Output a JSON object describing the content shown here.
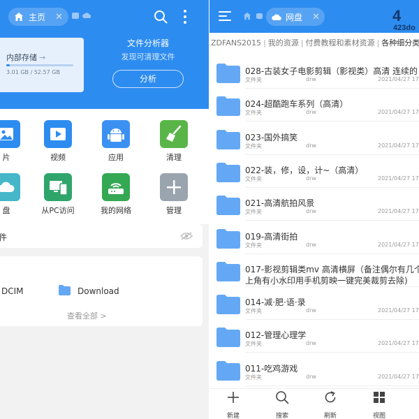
{
  "left": {
    "home_tab": {
      "label": "主页",
      "close": "✕"
    },
    "storage": {
      "title": "内部存储",
      "arrow": "→",
      "usage": "3.01 GB / 52.57 GB",
      "used_fraction": 0.057
    },
    "analyzer": {
      "title": "文件分析器",
      "subtitle": "发现可清理文件",
      "button": "分析"
    },
    "grid": [
      {
        "label": "片",
        "icon": "image-icon",
        "color": "#2d8cf0"
      },
      {
        "label": "视频",
        "icon": "video-icon",
        "color": "#2d8cf0"
      },
      {
        "label": "应用",
        "icon": "android-icon",
        "color": "#3b91f2"
      },
      {
        "label": "清理",
        "icon": "broom-icon",
        "color": "#59b548"
      },
      {
        "label": "盘",
        "icon": "cloud-icon",
        "color": "#45b7c9"
      },
      {
        "label": "从PC访问",
        "icon": "pc-access-icon",
        "color": "#30a56b"
      },
      {
        "label": "我的网络",
        "icon": "router-icon",
        "color": "#34a853"
      },
      {
        "label": "管理",
        "icon": "plus-icon",
        "color": "#9aa4af"
      }
    ],
    "recent": {
      "title": "件"
    },
    "files": {
      "dcim": "DCIM",
      "download": "Download",
      "view_all": "查看全部 >"
    }
  },
  "right": {
    "net_tab": {
      "label": "网盘",
      "close": "✕"
    },
    "watermark": {
      "big": "4",
      "small": "423do"
    },
    "breadcrumb": [
      "ZDFANS2015",
      "我的资源",
      "付费教程和素材资源",
      "各种细分类"
    ],
    "breadcrumb_sep": "|",
    "items": [
      {
        "name": "028-古装女子电影剪辑（影视类）高清  连续的",
        "type": "文件夹",
        "perm": "drw",
        "time": "2021/04/27 17:"
      },
      {
        "name": "024-超酷跑车系列（高清）",
        "type": "文件夹",
        "perm": "drw",
        "time": "2021/04/27 17:"
      },
      {
        "name": "023-国外搞笑",
        "type": "文件夹",
        "perm": "drw",
        "time": "2021/04/27 17:"
      },
      {
        "name": "022-装，修，设，计~（高清）",
        "type": "文件夹",
        "perm": "drw",
        "time": "2021/04/27 17:"
      },
      {
        "name": "021-高清航拍风景",
        "type": "文件夹",
        "perm": "drw",
        "time": "2021/04/27 17:"
      },
      {
        "name": "019-高清街拍",
        "type": "文件夹",
        "perm": "drw",
        "time": "2021/04/27 17:"
      },
      {
        "name": "017-影视剪辑类mv  高清横屏（备注偶尔有几个",
        "name2": "上角有小水印用手机剪映一键完美裁剪去除)",
        "type": "",
        "perm": "",
        "time": ""
      },
      {
        "name": "014-减·肥·语·录",
        "type": "文件夹",
        "perm": "drw",
        "time": "2021/04/27 17:"
      },
      {
        "name": "012-管理心理学",
        "type": "文件夹",
        "perm": "drw",
        "time": "2021/04/27 17:"
      },
      {
        "name": "011-吃鸡游戏",
        "type": "文件夹",
        "perm": "drw",
        "time": "2021/04/27 17:"
      }
    ],
    "bottom": [
      {
        "label": "新建",
        "icon": "plus-icon"
      },
      {
        "label": "搜索",
        "icon": "search-icon"
      },
      {
        "label": "刷新",
        "icon": "refresh-icon"
      },
      {
        "label": "视图",
        "icon": "grid-view-icon"
      }
    ]
  },
  "colors": {
    "primary": "#2d8cf0",
    "folder": "#64a8f5"
  }
}
